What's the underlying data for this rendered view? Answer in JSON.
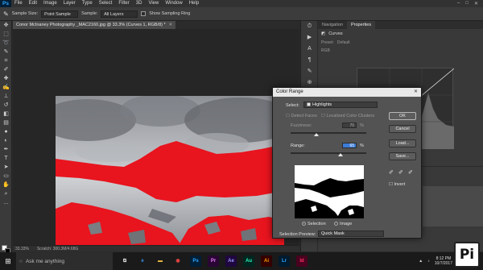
{
  "menu": {
    "app_badge": "Ps",
    "items": [
      "File",
      "Edit",
      "Image",
      "Layer",
      "Type",
      "Select",
      "Filter",
      "3D",
      "View",
      "Window",
      "Help"
    ]
  },
  "options": {
    "sample_size_label": "Sample Size:",
    "sample_size_value": "Point Sample",
    "sample_label": "Sample:",
    "sample_value": "All Layers",
    "show_ring_label": "Show Sampling Ring"
  },
  "document": {
    "tab_title": "Conor McInaney Photography _MAC2160.jpg @ 33.3% (Curves 1, RGB/8) *",
    "zoom": "33.33%",
    "scratch": "Scratch: 300.3M/4.68G"
  },
  "panels": {
    "tabs": [
      "Navigation",
      "Properties"
    ],
    "properties_title": "Curves",
    "preset_label": "Preset:",
    "preset_value": "Default",
    "channel_value": "RGB"
  },
  "dialog": {
    "title": "Color Range",
    "select_label": "Select:",
    "select_value": "Highlights",
    "detect_faces": "Detect Faces",
    "localized": "Localized Color Clusters",
    "fuzziness_label": "Fuzziness:",
    "fuzziness_value": "70",
    "fuzziness_unit": "%",
    "range_label": "Range:",
    "range_value": "65",
    "range_unit": "%",
    "selection_label": "Selection",
    "image_label": "Image",
    "preview_label": "Selection Preview:",
    "preview_value": "Quick Mask",
    "ok": "OK",
    "cancel": "Cancel",
    "load": "Load...",
    "save": "Save...",
    "invert": "Invert"
  },
  "taskbar": {
    "search_placeholder": "Ask me anything",
    "time": "8:12 PM",
    "date": "10/7/2017",
    "apps": [
      "Ps",
      "Pr",
      "Ae",
      "Au",
      "Ai",
      "Lr",
      "Id"
    ]
  },
  "badge": "Pi",
  "colors": {
    "selection_red": "#e8141e",
    "ps_blue": "#31a8ff",
    "dialog_bg": "#535353"
  }
}
